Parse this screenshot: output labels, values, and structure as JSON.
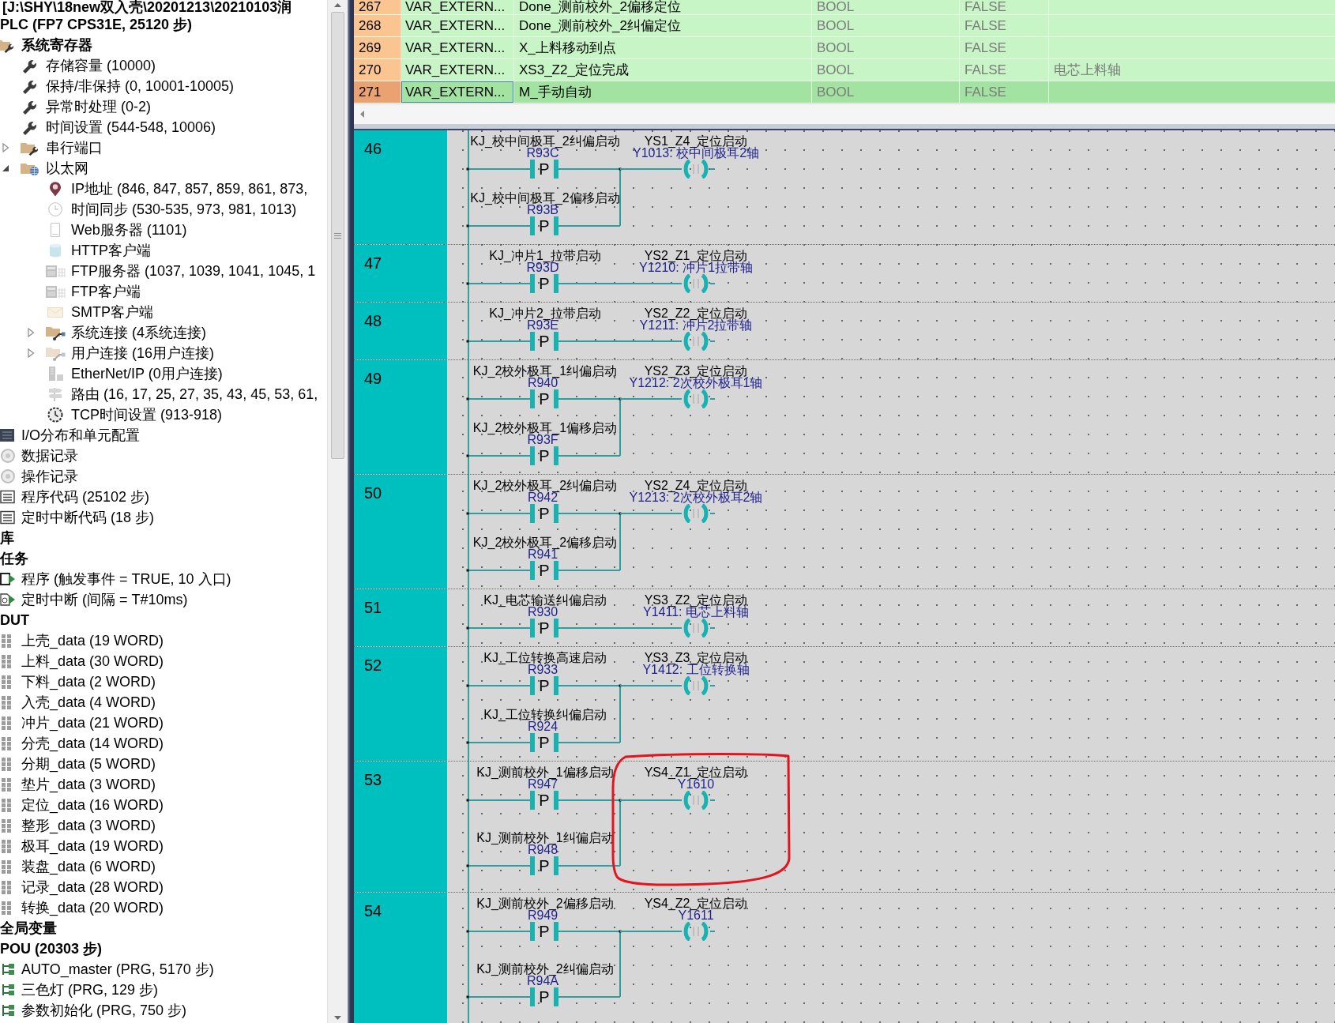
{
  "navigator": {
    "project_path": "[J:\\SHY\\18new双入壳\\20201213\\20210103润",
    "items": [
      {
        "text": "PLC (FP7 CPS31E, 25120 步)",
        "bold": true,
        "children": [
          {
            "text": "系统寄存器",
            "kind": "folder_wrench",
            "bold": true,
            "children": [
              {
                "text": "存储容量 (10000)",
                "kind": "wrench",
                "bold": false
              },
              {
                "text": "保持/非保持 (0, 10001-10005)",
                "kind": "wrench",
                "bold": false
              },
              {
                "text": "异常时处理 (0-2)",
                "kind": "wrench",
                "bold": false
              },
              {
                "text": "时间设置 (544-548, 10006)",
                "kind": "wrench",
                "bold": false
              },
              {
                "text": "串行端口",
                "kind": "folder_wrench",
                "bold": false,
                "expanded": false
              },
              {
                "text": "以太网",
                "kind": "folder_globe",
                "bold": false,
                "expanded": true,
                "children": [
                  {
                    "text": "IP地址 (846, 847, 857, 859, 861, 873,",
                    "kind": "ip",
                    "bold": false,
                    "enabled": true
                  },
                  {
                    "text": "时间同步 (530-535, 973, 981, 1013)",
                    "kind": "clock",
                    "bold": false,
                    "enabled": false
                  },
                  {
                    "text": "Web服务器 (1101)",
                    "kind": "tablet",
                    "bold": false,
                    "enabled": false
                  },
                  {
                    "text": "HTTP客户端",
                    "kind": "database",
                    "bold": false,
                    "enabled": false
                  },
                  {
                    "text": "FTP服务器 (1037, 1039, 1041, 1045, 1",
                    "kind": "ftp",
                    "bold": false,
                    "enabled": false
                  },
                  {
                    "text": "FTP客户端",
                    "kind": "ftp",
                    "bold": false,
                    "enabled": false
                  },
                  {
                    "text": "SMTP客户端",
                    "kind": "mail",
                    "bold": false,
                    "enabled": false
                  },
                  {
                    "text": "系统连接 (4系统连接)",
                    "kind": "folder_link",
                    "bold": false,
                    "enabled": true,
                    "expanded": false
                  },
                  {
                    "text": "用户连接 (16用户连接)",
                    "kind": "folder_link",
                    "bold": false,
                    "enabled": false,
                    "expanded": false
                  },
                  {
                    "text": "EtherNet/IP (0用户连接)",
                    "kind": "ethernet",
                    "bold": false,
                    "enabled": false
                  },
                  {
                    "text": "路由 (16, 17, 25, 27, 35, 43, 45, 53, 61,",
                    "kind": "route",
                    "bold": false,
                    "enabled": false
                  },
                  {
                    "text": "TCP时间设置 (913-918)",
                    "kind": "tcp_time",
                    "bold": false,
                    "enabled": true
                  }
                ]
              }
            ]
          },
          {
            "text": "I/O分布和单元配置",
            "kind": "io",
            "bold": false
          },
          {
            "text": "数据记录",
            "kind": "record",
            "bold": false
          },
          {
            "text": "操作记录",
            "kind": "record",
            "bold": false
          },
          {
            "text": "程序代码 (25102 步)",
            "kind": "code",
            "bold": false
          },
          {
            "text": "定时中断代码 (18 步)",
            "kind": "code",
            "bold": false
          }
        ]
      },
      {
        "text": "库",
        "bold": true
      },
      {
        "text": "任务",
        "bold": true,
        "children": [
          {
            "text": "程序 (触发事件 = TRUE, 10 入口)",
            "kind": "task",
            "bold": false
          },
          {
            "text": "定时中断 (间隔 = T#10ms)",
            "kind": "timer_task",
            "bold": false
          }
        ]
      },
      {
        "text": "DUT",
        "bold": true,
        "children": [
          {
            "text": "上壳_data (19 WORD)",
            "kind": "dut",
            "bold": false
          },
          {
            "text": "上料_data (30 WORD)",
            "kind": "dut",
            "bold": false
          },
          {
            "text": "下料_data (2 WORD)",
            "kind": "dut",
            "bold": false
          },
          {
            "text": "入壳_data (4 WORD)",
            "kind": "dut",
            "bold": false
          },
          {
            "text": "冲片_data (21 WORD)",
            "kind": "dut",
            "bold": false
          },
          {
            "text": "分壳_data (14 WORD)",
            "kind": "dut",
            "bold": false
          },
          {
            "text": "分期_data (5 WORD)",
            "kind": "dut",
            "bold": false
          },
          {
            "text": "垫片_data (3 WORD)",
            "kind": "dut",
            "bold": false
          },
          {
            "text": "定位_data (16 WORD)",
            "kind": "dut",
            "bold": false
          },
          {
            "text": "整形_data (3 WORD)",
            "kind": "dut",
            "bold": false
          },
          {
            "text": "极耳_data (19 WORD)",
            "kind": "dut",
            "bold": false
          },
          {
            "text": "装盘_data (6 WORD)",
            "kind": "dut",
            "bold": false
          },
          {
            "text": "记录_data (28 WORD)",
            "kind": "dut",
            "bold": false
          },
          {
            "text": "转换_data (20 WORD)",
            "kind": "dut",
            "bold": false
          }
        ]
      },
      {
        "text": "全局变量",
        "bold": true
      },
      {
        "text": "POU (20303 步)",
        "bold": true,
        "children": [
          {
            "text": "AUTO_master (PRG, 5170 步)",
            "kind": "pou",
            "bold": false
          },
          {
            "text": "三色灯 (PRG, 129 步)",
            "kind": "pou",
            "bold": false
          },
          {
            "text": "参数初始化 (PRG, 750 步)",
            "kind": "pou",
            "bold": false
          }
        ]
      }
    ]
  },
  "variable_table": {
    "rows": [
      {
        "column_1": "267",
        "column_2": "VAR_EXTERN...",
        "column_3": "Done_测前校外_2偏移定位",
        "column_4": "BOOL",
        "column_5": "FALSE",
        "selected": false
      },
      {
        "column_1": "268",
        "column_2": "VAR_EXTERN...",
        "column_3": "Done_测前校外_2纠偏定位",
        "column_4": "BOOL",
        "column_5": "FALSE",
        "selected": false
      },
      {
        "column_1": "269",
        "column_2": "VAR_EXTERN...",
        "column_3": "X_上料移动到点",
        "column_4": "BOOL",
        "column_5": "FALSE",
        "selected": false
      },
      {
        "column_1": "270",
        "column_2": "VAR_EXTERN...",
        "column_3": "XS3_Z2_定位完成",
        "column_4": "BOOL",
        "column_5": "FALSE",
        "column_6": "电芯上料轴",
        "selected": false
      },
      {
        "column_1": "271",
        "column_2": "VAR_EXTERN...",
        "column_3": "M_手动自动",
        "column_4": "BOOL",
        "column_5": "FALSE",
        "selected": true
      }
    ]
  },
  "ladder": {
    "rungs": [
      {
        "number": "46",
        "circled": false,
        "contacts": [
          {
            "label": "KJ_校中间极耳_2纠偏启动",
            "address": "R93C",
            "symbol": "P"
          },
          {
            "label": "KJ_校中间极耳_2偏移启动",
            "address": "R93B",
            "symbol": "P"
          }
        ],
        "coil": {
          "label": "YS1_Z4_定位启动",
          "address": "Y1013: 校中间极耳2轴"
        }
      },
      {
        "number": "47",
        "circled": false,
        "contacts": [
          {
            "label": "KJ_冲片1_拉带启动",
            "address": "R93D",
            "symbol": "P"
          }
        ],
        "coil": {
          "label": "YS2_Z1_定位启动",
          "address": "Y1210: 冲片1拉带轴"
        }
      },
      {
        "number": "48",
        "circled": false,
        "contacts": [
          {
            "label": "KJ_冲片2_拉带启动",
            "address": "R93E",
            "symbol": "P"
          }
        ],
        "coil": {
          "label": "YS2_Z2_定位启动",
          "address": "Y1211: 冲片2拉带轴"
        }
      },
      {
        "number": "49",
        "circled": false,
        "contacts": [
          {
            "label": "KJ_2校外极耳_1纠偏启动",
            "address": "R940",
            "symbol": "P"
          },
          {
            "label": "KJ_2校外极耳_1偏移启动",
            "address": "R93F",
            "symbol": "P"
          }
        ],
        "coil": {
          "label": "YS2_Z3_定位启动",
          "address": "Y1212: 2次校外极耳1轴"
        }
      },
      {
        "number": "50",
        "circled": false,
        "contacts": [
          {
            "label": "KJ_2校外极耳_2纠偏启动",
            "address": "R942",
            "symbol": "P"
          },
          {
            "label": "KJ_2校外极耳_2偏移启动",
            "address": "R941",
            "symbol": "P"
          }
        ],
        "coil": {
          "label": "YS2_Z4_定位启动",
          "address": "Y1213: 2次校外极耳2轴"
        }
      },
      {
        "number": "51",
        "circled": false,
        "contacts": [
          {
            "label": "KJ_电芯输送纠偏启动",
            "address": "R930",
            "symbol": "P"
          }
        ],
        "coil": {
          "label": "YS3_Z2_定位启动",
          "address": "Y1411: 电芯上料轴"
        }
      },
      {
        "number": "52",
        "circled": false,
        "contacts": [
          {
            "label": "KJ_工位转换高速启动",
            "address": "R933",
            "symbol": "P"
          },
          {
            "label": "KJ_工位转换纠偏启动",
            "address": "R924",
            "symbol": "P"
          }
        ],
        "coil": {
          "label": "YS3_Z3_定位启动",
          "address": "Y1412: 工位转换轴"
        }
      },
      {
        "number": "53",
        "circled": true,
        "contacts": [
          {
            "label": "KJ_测前校外_1偏移启动",
            "address": "R947",
            "symbol": "P"
          },
          {
            "label": "KJ_测前校外_1纠偏启动",
            "address": "R948",
            "symbol": "P"
          }
        ],
        "coil": {
          "label": "YS4_Z1_定位启动",
          "address": "Y1610"
        }
      },
      {
        "number": "54",
        "circled": false,
        "contacts": [
          {
            "label": "KJ_测前校外_2偏移启动",
            "address": "R949",
            "symbol": "P"
          },
          {
            "label": "KJ_测前校外_2纠偏启动",
            "address": "R94A",
            "symbol": "P"
          }
        ],
        "coil": {
          "label": "YS4_Z2_定位启动",
          "address": "Y1611"
        }
      }
    ]
  }
}
